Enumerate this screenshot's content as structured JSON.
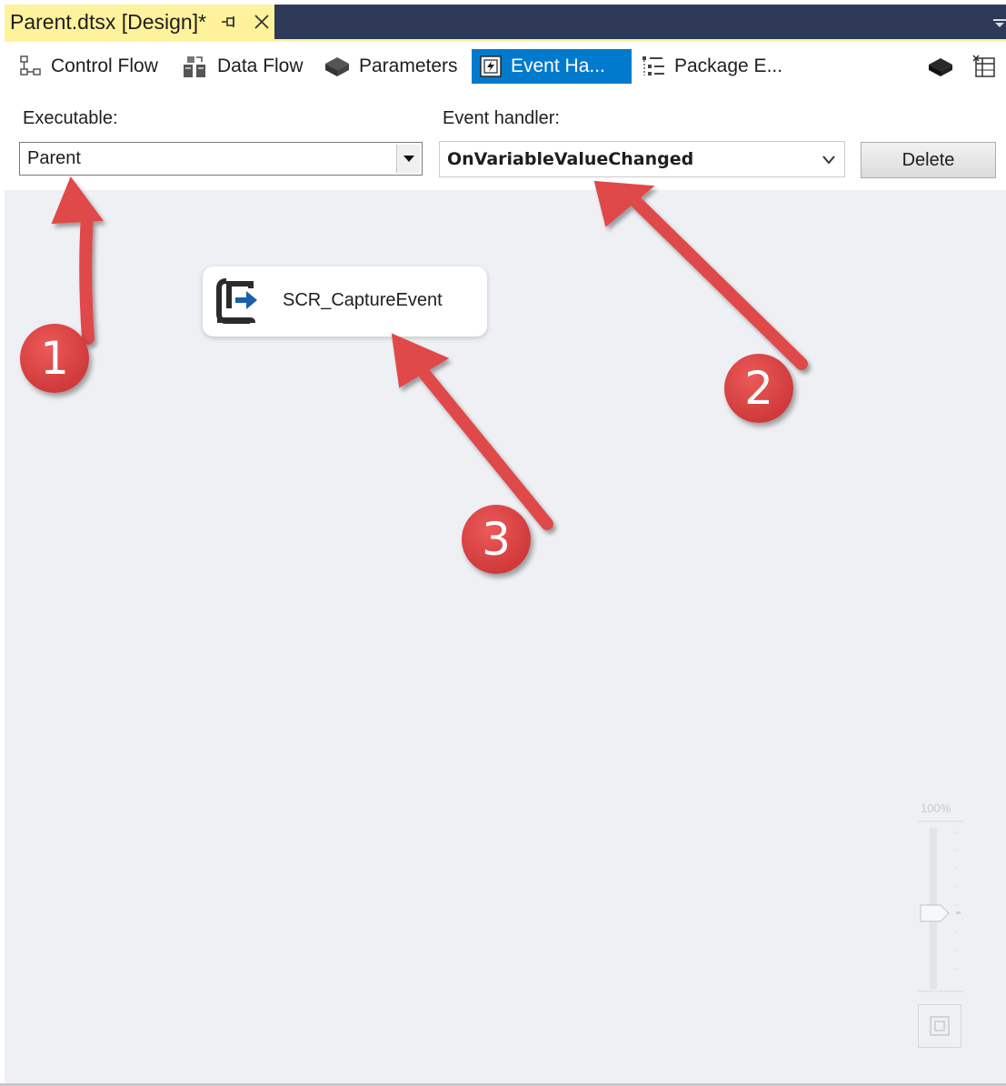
{
  "document_tab": {
    "title": "Parent.dtsx [Design]*",
    "pin_icon": "pin-icon",
    "close_icon": "close-icon"
  },
  "designer_tabs": [
    {
      "label": "Control Flow",
      "icon": "control-flow-icon",
      "active": false
    },
    {
      "label": "Data Flow",
      "icon": "data-flow-icon",
      "active": false
    },
    {
      "label": "Parameters",
      "icon": "parameters-icon",
      "active": false
    },
    {
      "label": "Event Ha...",
      "icon": "event-handlers-icon",
      "active": true
    },
    {
      "label": "Package E...",
      "icon": "package-explorer-icon",
      "active": false
    }
  ],
  "toolbar_icons": [
    "package-parts-icon",
    "variables-icon"
  ],
  "executable": {
    "label": "Executable:",
    "value": "Parent"
  },
  "event_handler": {
    "label": "Event handler:",
    "value": "OnVariableValueChanged"
  },
  "delete_button": "Delete",
  "task": {
    "label": "SCR_CaptureEvent",
    "icon": "script-task-icon"
  },
  "zoom": {
    "label": "100%"
  },
  "annotations": [
    "1",
    "2",
    "3"
  ],
  "colors": {
    "tab_strip": "#2d3956",
    "active_doc_tab": "#fff29d",
    "active_designer_tab": "#007acc",
    "canvas": "#eef0f4",
    "annotation": "#e04848"
  }
}
